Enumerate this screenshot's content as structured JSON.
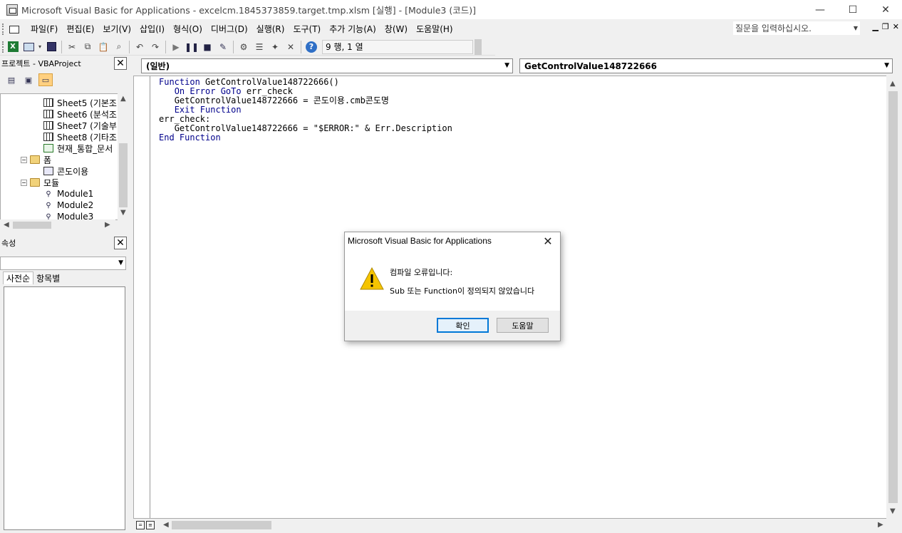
{
  "window": {
    "title": "Microsoft Visual Basic for Applications - excelcm.1845373859.target.tmp.xlsm [실행] - [Module3 (코드)]",
    "minimize": "—",
    "maximize": "☐",
    "close": "✕"
  },
  "menubar": {
    "items": [
      "파일(F)",
      "편집(E)",
      "보기(V)",
      "삽입(I)",
      "형식(O)",
      "디버그(D)",
      "실행(R)",
      "도구(T)",
      "추가 기능(A)",
      "창(W)",
      "도움말(H)"
    ],
    "help_box": "질문을 입력하십시오."
  },
  "toolbar": {
    "position_text": "9 행, 1 열"
  },
  "project_pane": {
    "title": "프로젝트 - VBAProject",
    "tree": [
      {
        "label": "Sheet5 (기본조",
        "icon": "sheet-icon"
      },
      {
        "label": "Sheet6 (분석조",
        "icon": "sheet-icon"
      },
      {
        "label": "Sheet7 (기술부",
        "icon": "sheet-icon"
      },
      {
        "label": "Sheet8 (기타조",
        "icon": "sheet-icon"
      },
      {
        "label": "현재_통합_문서",
        "icon": "workbook-icon"
      },
      {
        "label": "폼",
        "icon": "folder-icon"
      },
      {
        "label": "콘도이용",
        "icon": "form-icon"
      },
      {
        "label": "모듈",
        "icon": "folder-icon"
      },
      {
        "label": "Module1",
        "icon": "module-icon"
      },
      {
        "label": "Module2",
        "icon": "module-icon"
      },
      {
        "label": "Module3",
        "icon": "module-icon"
      }
    ]
  },
  "properties_pane": {
    "title": "속성",
    "tabs": [
      "사전순",
      "항목별"
    ]
  },
  "code_window": {
    "object_combo": "(일반)",
    "procedure_combo": "GetControlValue148722666",
    "lines": [
      "Function GetControlValue148722666()",
      "   On Error GoTo err_check",
      "   GetControlValue148722666 = 콘도이용.cmb콘도명",
      "   Exit Function",
      "err_check:",
      "   GetControlValue148722666 = \"$ERROR:\" & Err.Description",
      "End Function"
    ]
  },
  "dialog": {
    "title": "Microsoft Visual Basic for Applications",
    "message_title": "컴파일 오류입니다:",
    "message_detail": "Sub 또는 Function이 정의되지 않았습니다",
    "ok_label": "확인",
    "help_label": "도움말",
    "icon": "warning-icon"
  },
  "colors": {
    "keyword": "#00008b",
    "default_button_border": "#0078d7",
    "warning": "#f5c400"
  }
}
